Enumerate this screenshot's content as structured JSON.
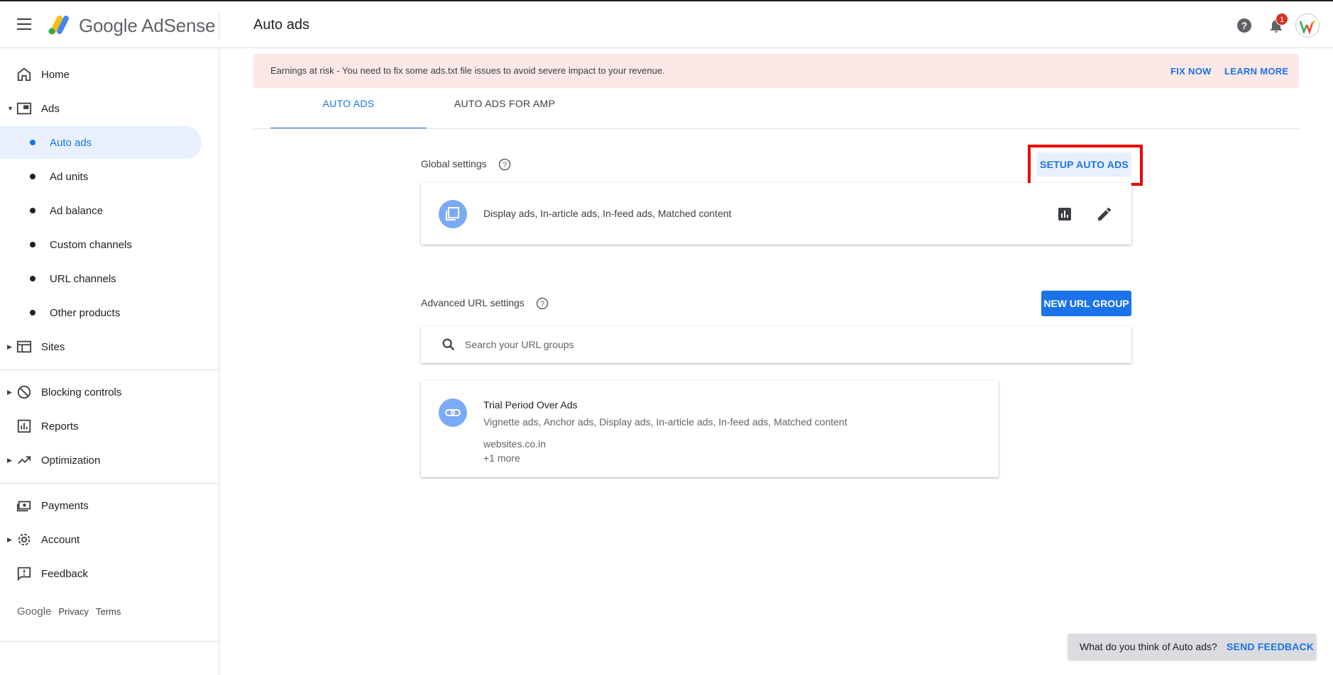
{
  "header": {
    "brand": "Google AdSense",
    "page_title": "Auto ads",
    "notification_count": "1"
  },
  "sidebar": {
    "home": "Home",
    "ads": "Ads",
    "sub_items": [
      "Auto ads",
      "Ad units",
      "Ad balance",
      "Custom channels",
      "URL channels",
      "Other products"
    ],
    "sites": "Sites",
    "blocking": "Blocking controls",
    "reports": "Reports",
    "optimization": "Optimization",
    "payments": "Payments",
    "account": "Account",
    "feedback": "Feedback",
    "footer": {
      "google": "Google",
      "privacy": "Privacy",
      "terms": "Terms"
    }
  },
  "alert": {
    "text": "Earnings at risk - You need to fix some ads.txt file issues to avoid severe impact to your revenue.",
    "fix_now": "FIX NOW",
    "learn_more": "LEARN MORE"
  },
  "tabs": [
    "AUTO ADS",
    "AUTO ADS FOR AMP"
  ],
  "global": {
    "title": "Global settings",
    "setup_button": "SETUP AUTO ADS",
    "ad_types": "Display ads, In-article ads, In-feed ads, Matched content"
  },
  "advanced": {
    "title": "Advanced URL settings",
    "new_group_button": "NEW URL GROUP",
    "search_placeholder": "Search your URL groups",
    "group": {
      "name": "Trial Period Over Ads",
      "ad_types": "Vignette ads, Anchor ads, Display ads, In-article ads, In-feed ads, Matched content",
      "site": "websites.co.in",
      "more": "+1 more"
    }
  },
  "snackbar": {
    "text": "What do you think of Auto ads?",
    "button": "SEND FEEDBACK"
  },
  "colors": {
    "accent": "#1a73e8",
    "alert_bg": "#fce8e6",
    "highlight": "#e00000"
  }
}
